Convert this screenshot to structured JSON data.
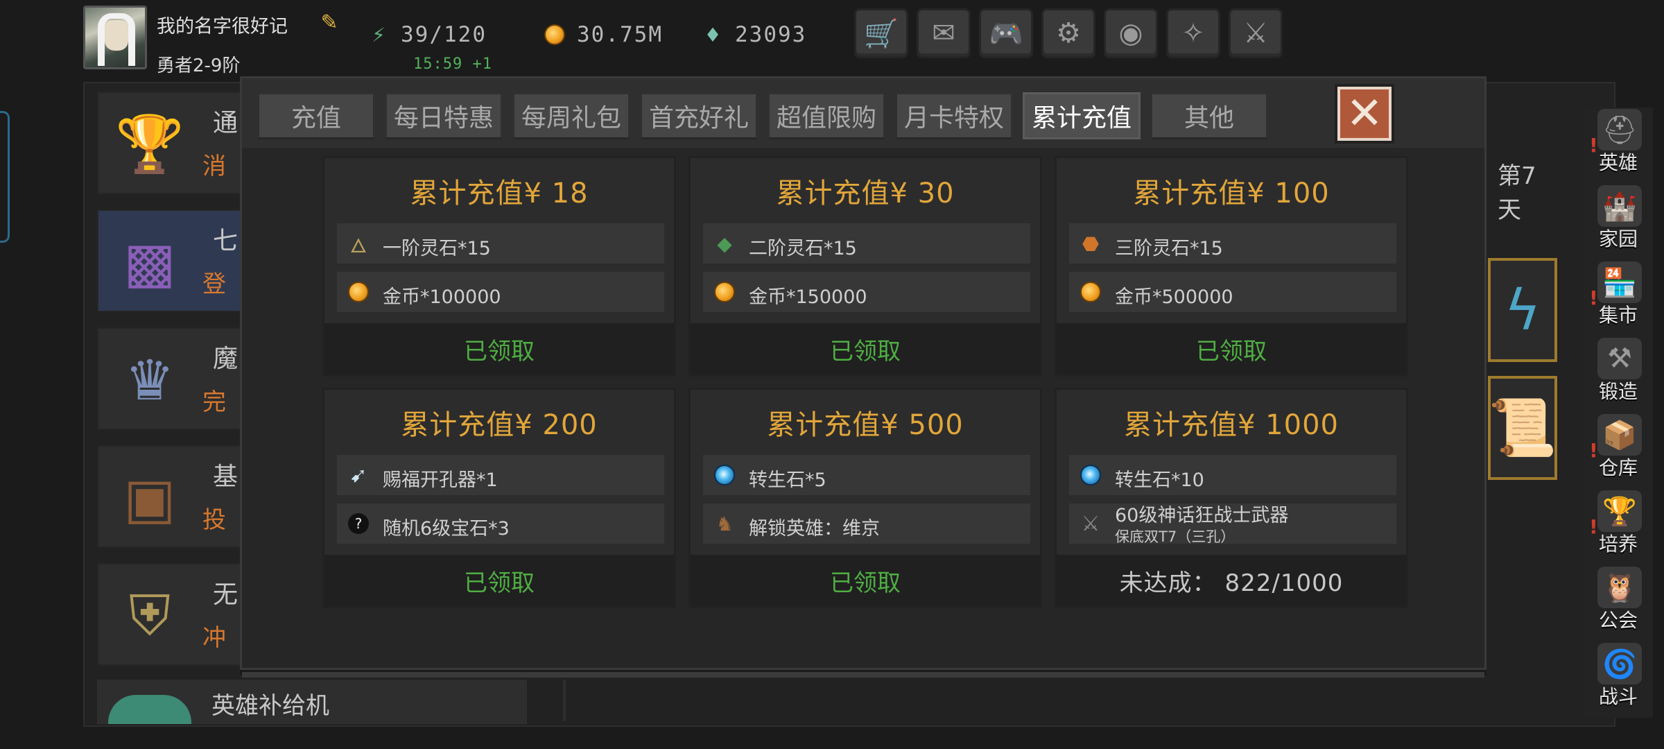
{
  "player": {
    "name": "我的名字很好记",
    "rank": "勇者2-9阶"
  },
  "resources": {
    "energy": "39/120",
    "energy_timer": "15:59 +1",
    "gold": "30.75M",
    "diamond": "23093"
  },
  "top_buttons": [
    {
      "name": "shop-cart-icon",
      "glyph": "🛒"
    },
    {
      "name": "mail-icon",
      "glyph": "✉"
    },
    {
      "name": "gamepad-icon",
      "glyph": "🎮"
    },
    {
      "name": "gear-icon",
      "glyph": "⚙"
    },
    {
      "name": "color-wheel-icon",
      "glyph": "◉"
    },
    {
      "name": "spark-icon",
      "glyph": "✧"
    },
    {
      "name": "crossed-swords-icon",
      "glyph": "⚔"
    }
  ],
  "background_list": {
    "items": [
      {
        "t1": "通",
        "t2": "消"
      },
      {
        "t1": "七",
        "t2": "登"
      },
      {
        "t1": "魔",
        "t2": "完"
      },
      {
        "t1": "基",
        "t2": "投"
      },
      {
        "t1": "无",
        "t2": "冲"
      }
    ],
    "supply_label": "英雄补给机",
    "day_label": "第7天"
  },
  "sidebar": [
    {
      "label": "英雄",
      "alert": true,
      "glyph": "⛑"
    },
    {
      "label": "家园",
      "alert": false,
      "glyph": "🏰"
    },
    {
      "label": "集市",
      "alert": true,
      "glyph": "🏪"
    },
    {
      "label": "锻造",
      "alert": false,
      "glyph": "⚒"
    },
    {
      "label": "仓库",
      "alert": true,
      "glyph": "📦"
    },
    {
      "label": "培养",
      "alert": true,
      "glyph": "🏆"
    },
    {
      "label": "公会",
      "alert": false,
      "glyph": "🦉"
    },
    {
      "label": "战斗",
      "alert": false,
      "glyph": "🌀"
    }
  ],
  "tabs": [
    "充值",
    "每日特惠",
    "每周礼包",
    "首充好礼",
    "超值限购",
    "月卡特权",
    "累计充值",
    "其他"
  ],
  "active_tab": 6,
  "cards": [
    {
      "title": "累计充值¥ 18",
      "rows": [
        {
          "icon": "stone-tier1-icon",
          "text": "一阶灵石*15"
        },
        {
          "icon": "gold-coin-icon",
          "text": "金币*100000"
        }
      ],
      "status": "已领取",
      "claimed": true
    },
    {
      "title": "累计充值¥ 30",
      "rows": [
        {
          "icon": "stone-tier2-icon",
          "text": "二阶灵石*15"
        },
        {
          "icon": "gold-coin-icon",
          "text": "金币*150000"
        }
      ],
      "status": "已领取",
      "claimed": true
    },
    {
      "title": "累计充值¥ 100",
      "rows": [
        {
          "icon": "stone-tier3-icon",
          "text": "三阶灵石*15"
        },
        {
          "icon": "gold-coin-icon",
          "text": "金币*500000"
        }
      ],
      "status": "已领取",
      "claimed": true
    },
    {
      "title": "累计充值¥ 200",
      "rows": [
        {
          "icon": "drill-tool-icon",
          "text": "赐福开孔器*1"
        },
        {
          "icon": "random-gem-icon",
          "text": "随机6级宝石*3"
        }
      ],
      "status": "已领取",
      "claimed": true
    },
    {
      "title": "累计充值¥ 500",
      "rows": [
        {
          "icon": "rebirth-stone-icon",
          "text": "转生石*5"
        },
        {
          "icon": "hero-unlock-icon",
          "text": "解锁英雄：维京"
        }
      ],
      "status": "已领取",
      "claimed": true
    },
    {
      "title": "累计充值¥ 1000",
      "rows": [
        {
          "icon": "rebirth-stone-icon",
          "text": "转生石*10"
        },
        {
          "icon": "mythic-weapon-icon",
          "text": "60级神话狂战士武器",
          "sub": "保底双T7（三孔）"
        }
      ],
      "status": "未达成： 822/1000",
      "claimed": false
    }
  ],
  "colors": {
    "title_gold": "#e2a63a",
    "claimed_green": "#4fae43",
    "close_red": "#b0593a",
    "orange_text": "#d9782d"
  }
}
